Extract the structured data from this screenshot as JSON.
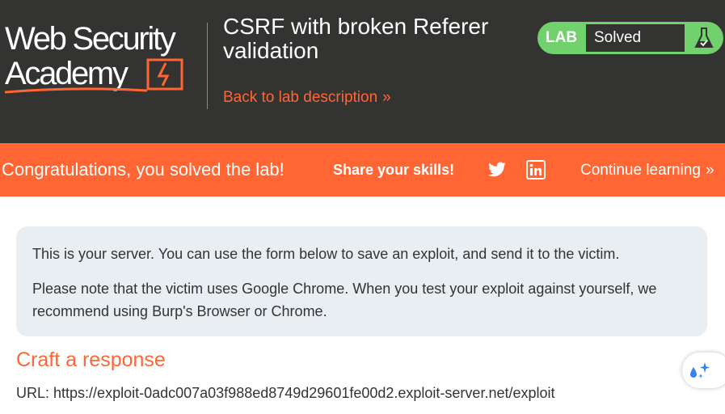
{
  "header": {
    "logo_line1": "Web Security",
    "logo_line2": "Academy",
    "lab_title": "CSRF with broken Referer validation",
    "back_link": "Back to lab description",
    "back_chevron": "»",
    "status_label": "LAB",
    "status_value": "Solved"
  },
  "banner": {
    "message": "Congratulations, you solved the lab!",
    "share": "Share your skills!",
    "continue": "Continue learning",
    "continue_chevron": "»"
  },
  "info": {
    "paragraph1": "This is your server. You can use the form below to save an exploit, and send it to the victim.",
    "paragraph2": "Please note that the victim uses Google Chrome. When you test your exploit against yourself, we recommend using Burp's Browser or Chrome."
  },
  "form": {
    "section_title": "Craft a response",
    "url_label": "URL:",
    "url_value": "https://exploit-0adc007a03f988ed8749d29601fe00d2.exploit-server.net/exploit"
  },
  "icons": {
    "logo_bolt": "lightning-bolt-icon",
    "flask": "flask-icon",
    "twitter": "twitter-icon",
    "linkedin": "linkedin-icon",
    "sparkle": "sparkle-icon"
  },
  "colors": {
    "header_bg": "#333332",
    "accent_orange": "#ff6633",
    "solved_green": "#70d16d",
    "info_bg": "#e9eef2",
    "text": "#333333"
  }
}
